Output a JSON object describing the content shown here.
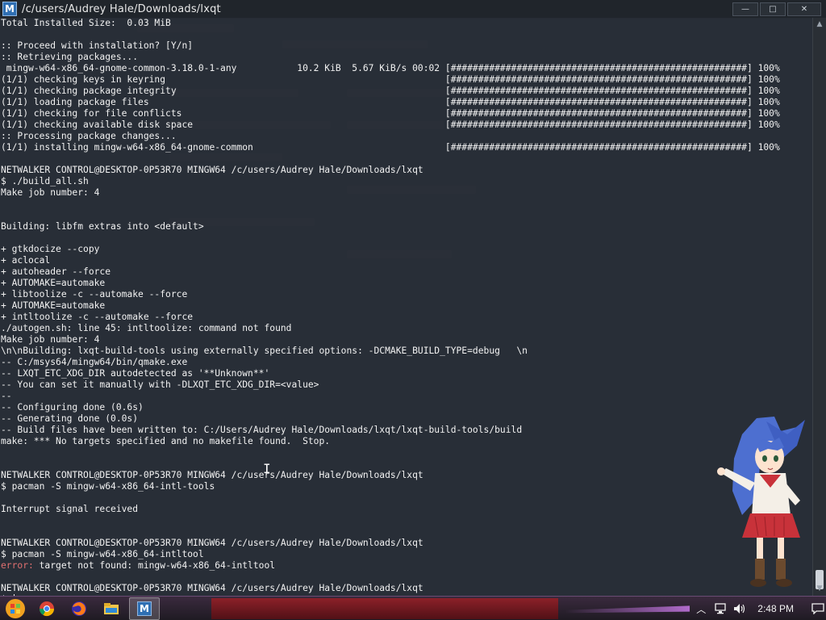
{
  "window": {
    "icon_letter": "M",
    "title": "/c/users/Audrey Hale/Downloads/lxqt",
    "minimize_label": "—",
    "maximize_label": "□",
    "close_label": "✕"
  },
  "terminal": {
    "lines": [
      {
        "text": "Total Installed Size:  0.03 MiB"
      },
      {
        "text": ""
      },
      {
        "text": ":: Proceed with installation? [Y/n]"
      },
      {
        "text": ":: Retrieving packages..."
      },
      {
        "text": " mingw-w64-x86_64-gnome-common-3.18.0-1-any           10.2 KiB  5.67 KiB/s 00:02 [######################################################] 100%"
      },
      {
        "text": "(1/1) checking keys in keyring                                                   [######################################################] 100%"
      },
      {
        "text": "(1/1) checking package integrity                                                 [######################################################] 100%"
      },
      {
        "text": "(1/1) loading package files                                                      [######################################################] 100%"
      },
      {
        "text": "(1/1) checking for file conflicts                                                [######################################################] 100%"
      },
      {
        "text": "(1/1) checking available disk space                                              [######################################################] 100%"
      },
      {
        "text": ":: Processing package changes..."
      },
      {
        "text": "(1/1) installing mingw-w64-x86_64-gnome-common                                   [######################################################] 100%"
      },
      {
        "text": ""
      },
      {
        "text": "NETWALKER CONTROL@DESKTOP-0P53R70 MINGW64 /c/users/Audrey Hale/Downloads/lxqt"
      },
      {
        "text": "$ ./build_all.sh"
      },
      {
        "text": "Make job number: 4"
      },
      {
        "text": ""
      },
      {
        "text": ""
      },
      {
        "text": "Building: libfm extras into <default>"
      },
      {
        "text": ""
      },
      {
        "text": "+ gtkdocize --copy"
      },
      {
        "text": "+ aclocal"
      },
      {
        "text": "+ autoheader --force"
      },
      {
        "text": "+ AUTOMAKE=automake"
      },
      {
        "text": "+ libtoolize -c --automake --force"
      },
      {
        "text": "+ AUTOMAKE=automake"
      },
      {
        "text": "+ intltoolize -c --automake --force"
      },
      {
        "text": "./autogen.sh: line 45: intltoolize: command not found"
      },
      {
        "text": "Make job number: 4"
      },
      {
        "text": "\\n\\nBuilding: lxqt-build-tools using externally specified options: -DCMAKE_BUILD_TYPE=debug   \\n"
      },
      {
        "text": "-- C:/msys64/mingw64/bin/qmake.exe"
      },
      {
        "text": "-- LXQT_ETC_XDG_DIR autodetected as '**Unknown**'"
      },
      {
        "text": "-- You can set it manually with -DLXQT_ETC_XDG_DIR=<value>"
      },
      {
        "text": "--"
      },
      {
        "text": "-- Configuring done (0.6s)"
      },
      {
        "text": "-- Generating done (0.0s)"
      },
      {
        "text": "-- Build files have been written to: C:/Users/Audrey Hale/Downloads/lxqt/lxqt-build-tools/build"
      },
      {
        "text": "make: *** No targets specified and no makefile found.  Stop."
      },
      {
        "text": ""
      },
      {
        "text": ""
      },
      {
        "text": "NETWALKER CONTROL@DESKTOP-0P53R70 MINGW64 /c/users/Audrey Hale/Downloads/lxqt"
      },
      {
        "text": "$ pacman -S mingw-w64-x86_64-intl-tools"
      },
      {
        "text": ""
      },
      {
        "text": "Interrupt signal received"
      },
      {
        "text": ""
      },
      {
        "text": ""
      },
      {
        "text": "NETWALKER CONTROL@DESKTOP-0P53R70 MINGW64 /c/users/Audrey Hale/Downloads/lxqt"
      },
      {
        "text": "$ pacman -S mingw-w64-x86_64-intltool"
      },
      {
        "text": "target not found: mingw-w64-x86_64-intltool",
        "prefix": "error: "
      },
      {
        "text": ""
      },
      {
        "text": "NETWALKER CONTROL@DESKTOP-0P53R70 MINGW64 /c/users/Audrey Hale/Downloads/lxqt"
      },
      {
        "text": "$ ",
        "cursor": true
      }
    ]
  },
  "colors": {
    "terminal_bg": "#282e36",
    "terminal_fg": "#f2f2f2",
    "error": "#e07070",
    "taskbar_accent": "#9a1f25"
  },
  "taskbar": {
    "start_icon": "start-orb-icon",
    "apps": [
      {
        "name": "chrome",
        "icon": "chrome-icon"
      },
      {
        "name": "firefox",
        "icon": "firefox-icon"
      },
      {
        "name": "explorer",
        "icon": "folder-icon"
      },
      {
        "name": "msys2",
        "icon": "msys2-icon",
        "label": "M",
        "active": true
      }
    ],
    "tray_icons": [
      "chevron-up-icon",
      "network-icon",
      "volume-icon"
    ],
    "clock": "2:48 PM",
    "notification_icon": "notification-icon"
  }
}
